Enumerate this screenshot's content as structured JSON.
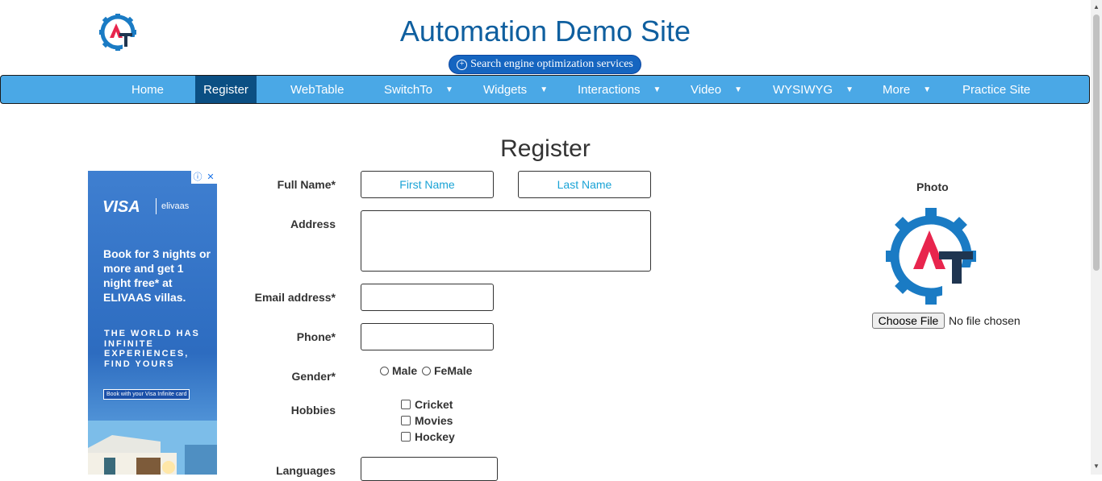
{
  "header": {
    "title": "Automation Demo Site",
    "seo_button": "Search engine optimization services"
  },
  "nav": {
    "items": [
      {
        "label": "Home"
      },
      {
        "label": "Register",
        "active": true
      },
      {
        "label": "WebTable"
      },
      {
        "label": "SwitchTo",
        "dropdown": true
      },
      {
        "label": "Widgets",
        "dropdown": true
      },
      {
        "label": "Interactions",
        "dropdown": true
      },
      {
        "label": "Video",
        "dropdown": true
      },
      {
        "label": "WYSIWYG",
        "dropdown": true
      },
      {
        "label": "More",
        "dropdown": true
      },
      {
        "label": "Practice Site"
      }
    ],
    "caret": "⌄"
  },
  "page": {
    "heading": "Register"
  },
  "ad": {
    "brand": "VISA",
    "brand2": "elivaas",
    "headline": "Book for 3 nights or more and get 1 night free* at ELIVAAS villas.",
    "subline": "THE WORLD HAS INFINITE EXPERIENCES, FIND YOURS",
    "cta": "Book with your Visa Infinite card",
    "info_icon": "ⓘ",
    "close_icon": "✕"
  },
  "form": {
    "full_name_label": "Full Name*",
    "first_name_placeholder": "First Name",
    "last_name_placeholder": "Last Name",
    "address_label": "Address",
    "email_label": "Email address*",
    "phone_label": "Phone*",
    "gender_label": "Gender*",
    "gender_options": [
      "Male",
      "FeMale"
    ],
    "hobbies_label": "Hobbies",
    "hobbies": [
      "Cricket",
      "Movies",
      "Hockey"
    ],
    "languages_label": "Languages"
  },
  "photo": {
    "label": "Photo",
    "choose_button": "Choose File",
    "no_file_text": "No file chosen"
  },
  "colors": {
    "brand_blue": "#0f5f9f",
    "nav_bg": "#4aa8e6",
    "nav_active": "#0b4f83",
    "placeholder": "#1aa3d6",
    "logo_red": "#e8254d",
    "logo_navy": "#1f3550",
    "logo_gear": "#1a7bc4"
  }
}
